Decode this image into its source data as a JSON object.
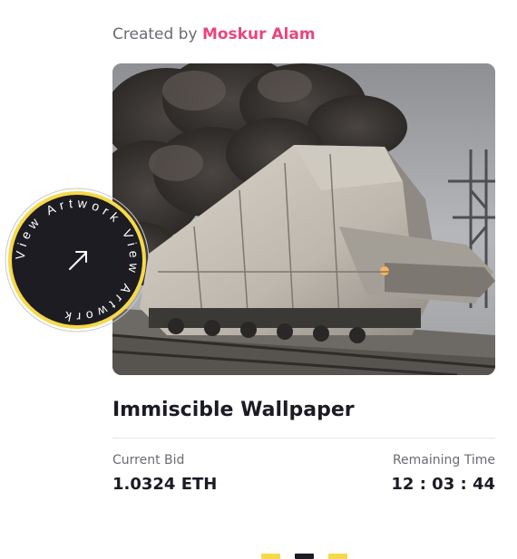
{
  "card": {
    "created_by_label": "Created by",
    "creator_name": "Moskur Alam",
    "badge_text": "View Artwork View Artwork",
    "title": "Immiscible Wallpaper",
    "bid": {
      "label": "Current Bid",
      "value": "1.0324 ETH"
    },
    "time": {
      "label": "Remaining Time",
      "value": "12 : 03 : 44"
    }
  },
  "pager": {
    "active_index": 1,
    "count": 3
  },
  "colors": {
    "creator": "#e8467c",
    "badge_fill": "#1c1c22",
    "badge_ring": "#f5d94a",
    "pager_active": "#1c1c22",
    "pager_inactive": "#f5d94a"
  },
  "icons": {
    "badge_arrow": "arrow-up-right-icon"
  }
}
